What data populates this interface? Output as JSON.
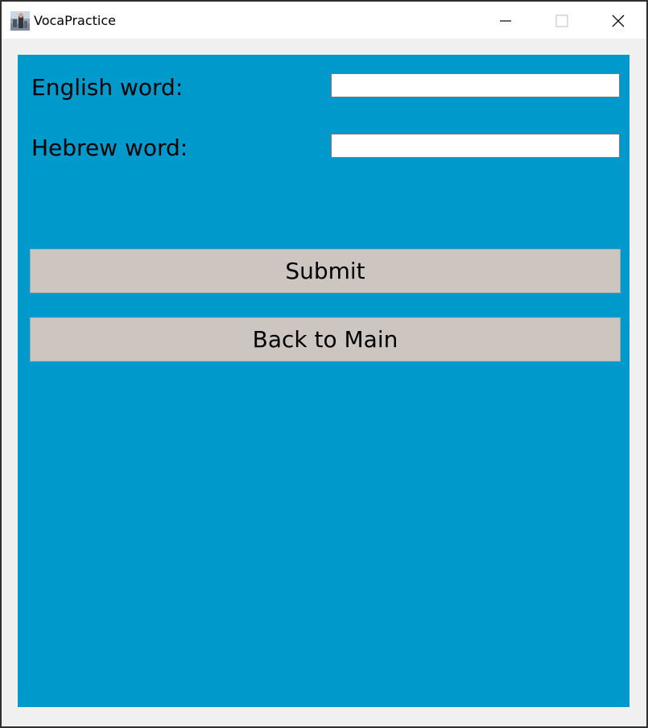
{
  "window": {
    "title": "VocaPractice",
    "app_icon": "app-photo-icon",
    "controls": {
      "minimize_icon": "minimize-icon",
      "maximize_icon": "maximize-icon",
      "close_icon": "close-icon"
    }
  },
  "form": {
    "background_color": "#0099cc",
    "button_color": "#cdc5c0",
    "english_label": "English word:",
    "english_value": "",
    "hebrew_label": "Hebrew word:",
    "hebrew_value": ""
  },
  "buttons": {
    "submit_label": "Submit",
    "back_label": "Back to Main"
  }
}
